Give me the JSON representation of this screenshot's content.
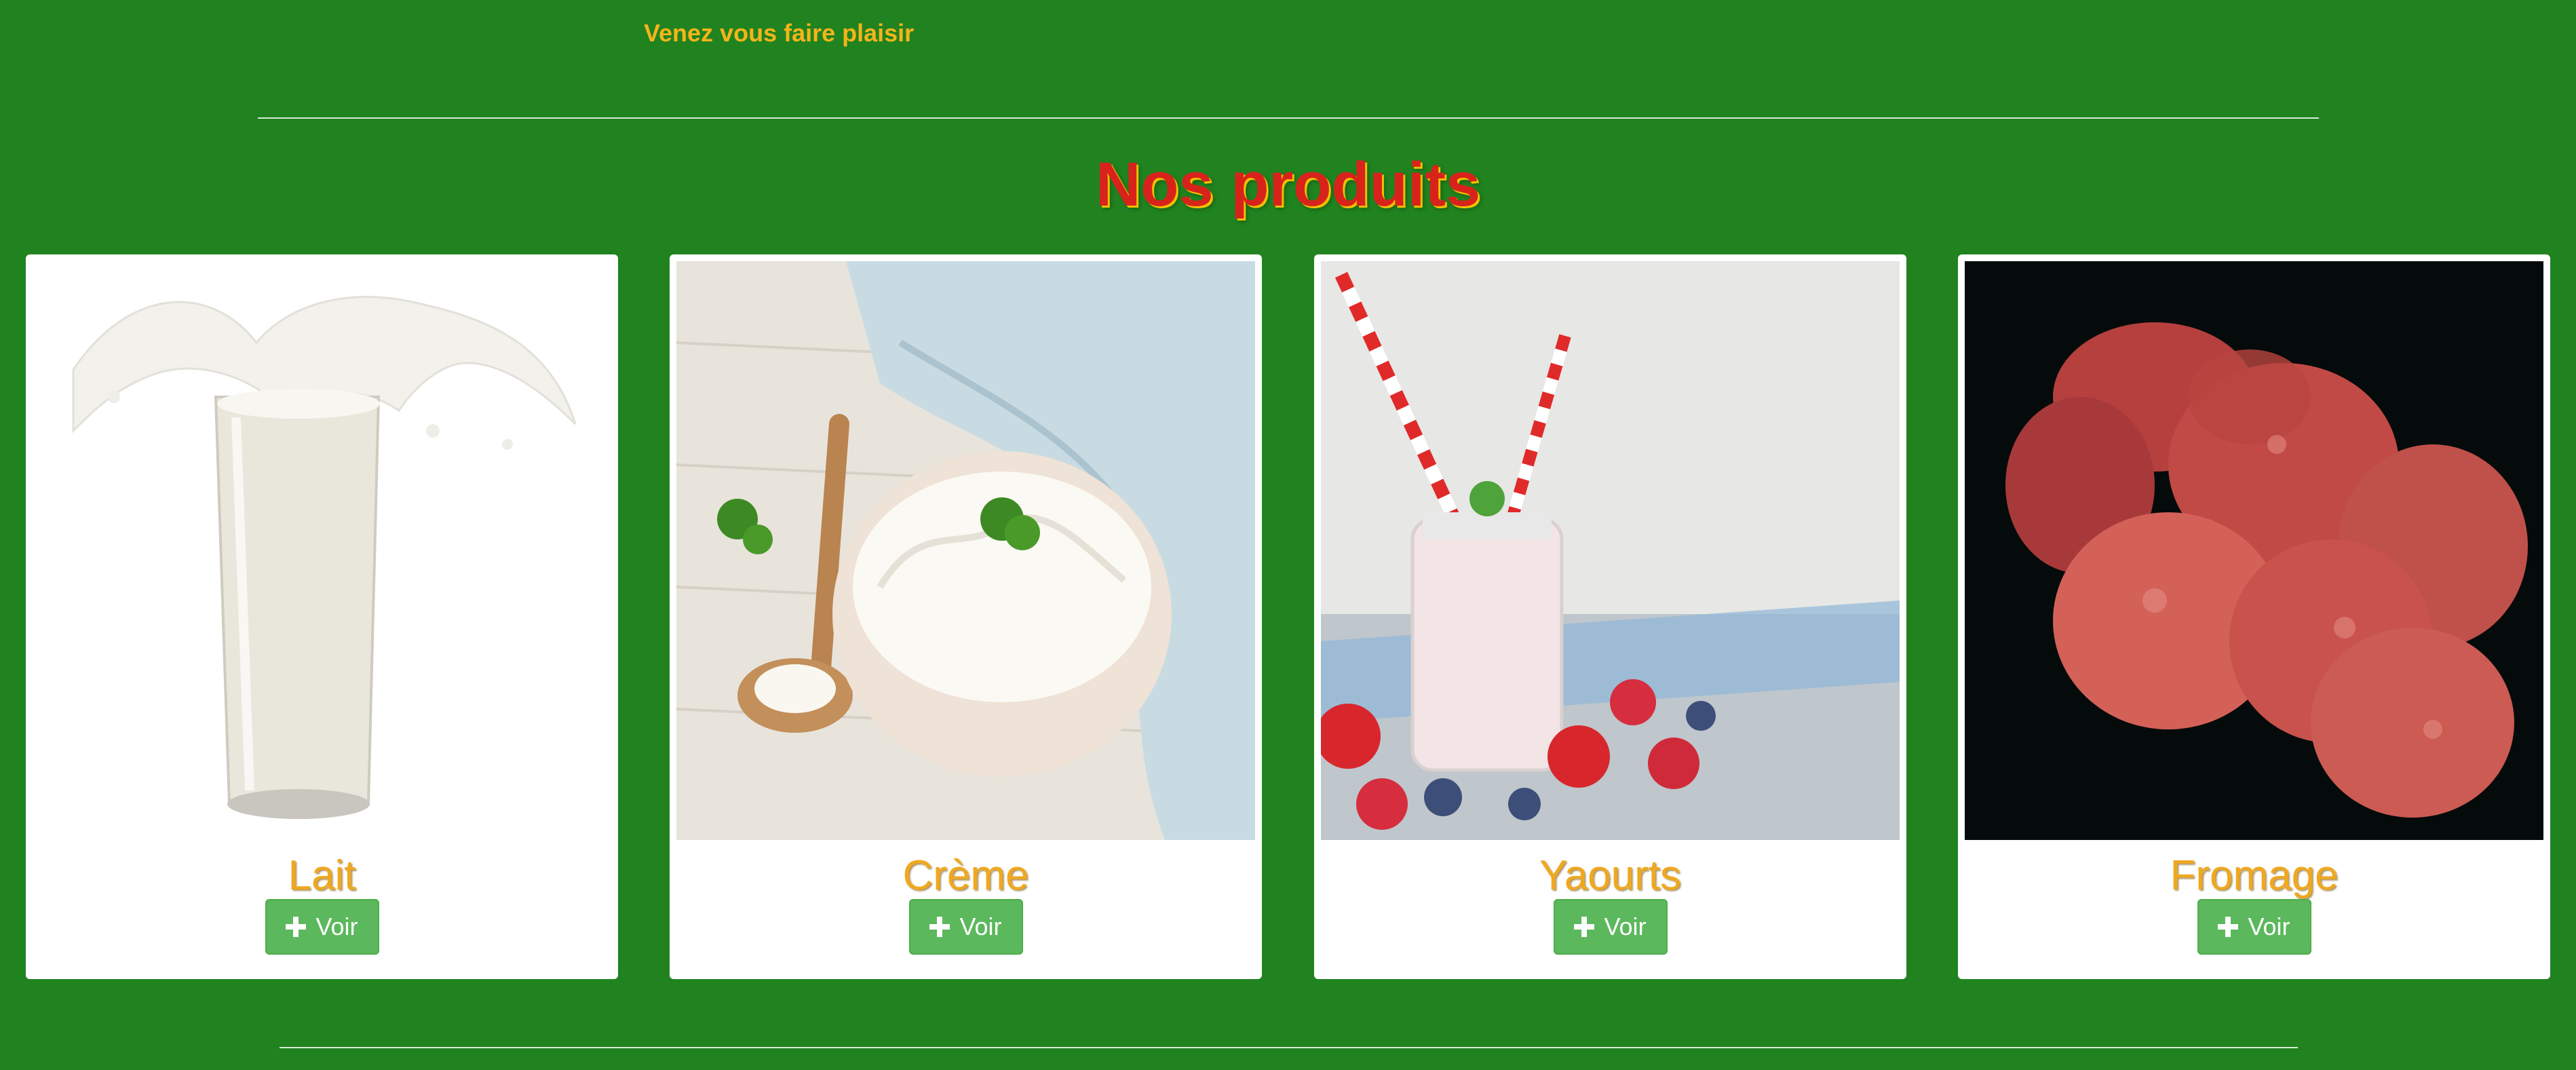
{
  "header": {
    "tagline": "Venez vous faire plaisir"
  },
  "products_section": {
    "title": "Nos produits",
    "products": [
      {
        "name": "Lait",
        "button_label": "Voir",
        "image": "milk-glass-splash"
      },
      {
        "name": "Crème",
        "button_label": "Voir",
        "image": "cream-bowl-spoon"
      },
      {
        "name": "Yaourts",
        "button_label": "Voir",
        "image": "yogurt-jar-berries"
      },
      {
        "name": "Fromage",
        "button_label": "Voir",
        "image": "red-cheese-rounds"
      }
    ]
  },
  "colors": {
    "page_background": "#20831f",
    "tagline": "#f5b41a",
    "title": "#d8231b",
    "product_name": "#f0a81e",
    "button": "#5cb85c"
  }
}
